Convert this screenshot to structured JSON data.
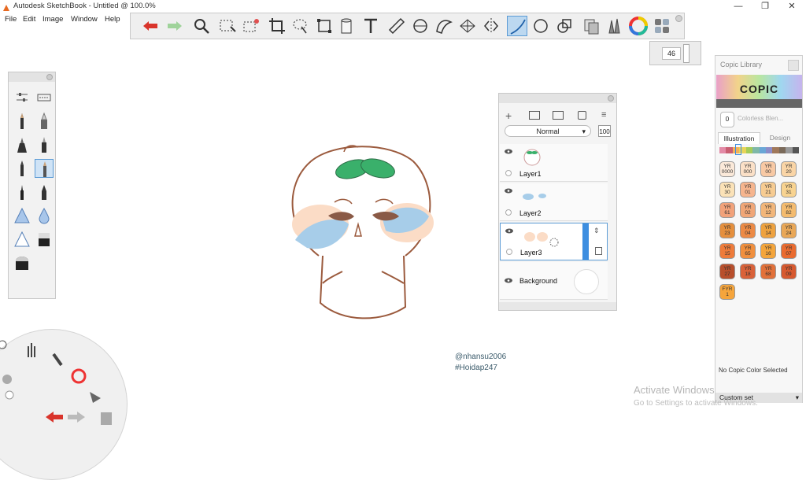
{
  "window": {
    "title": "Autodesk SketchBook - Untitled @ 100.0%",
    "controls": [
      "—",
      "❐",
      "✕"
    ]
  },
  "menu": {
    "items": [
      "File",
      "Edit",
      "Image",
      "Window",
      "Help"
    ]
  },
  "toolbar": {
    "tools": [
      "undo-icon",
      "redo-icon",
      "zoom-icon",
      "select-icon",
      "magic-select-icon",
      "crop-icon",
      "lasso-icon",
      "transform-icon",
      "fill-icon",
      "text-icon",
      "ruler-icon",
      "ellipse-guide-icon",
      "french-curve-icon",
      "perspective-icon",
      "symmetry-icon",
      "stroke-icon",
      "ellipse-icon",
      "shape-icon",
      "copy-icon",
      "brush-library-icon",
      "color-wheel-icon",
      "layout-icon"
    ],
    "selected": "stroke-icon"
  },
  "brush_size": {
    "value": "46"
  },
  "layer_editor": {
    "blend_mode": "Normal",
    "opacity": "100",
    "layers": [
      {
        "name": "Layer1"
      },
      {
        "name": "Layer2"
      },
      {
        "name": "Layer3",
        "selected": true
      },
      {
        "name": "Background"
      }
    ]
  },
  "copic": {
    "title": "Copic Library",
    "logo": "COPIC",
    "colorless_blender": {
      "code": "0",
      "label": "Colorless Blen..."
    },
    "tabs": [
      "Illustration",
      "Design"
    ],
    "active_tab": "Illustration",
    "chips": [
      {
        "code": "YR\n0000",
        "color": "#fbe9d9"
      },
      {
        "code": "YR\n000",
        "color": "#fbe0c7"
      },
      {
        "code": "YR\n00",
        "color": "#f8c9a4"
      },
      {
        "code": "YR\n20",
        "color": "#fad5a6"
      },
      {
        "code": "YR\n30",
        "color": "#fbe2b7"
      },
      {
        "code": "YR\n01",
        "color": "#f6b58e"
      },
      {
        "code": "YR\n21",
        "color": "#f7cc92"
      },
      {
        "code": "YR\n31",
        "color": "#f8d390"
      },
      {
        "code": "YR\n61",
        "color": "#f2a27a"
      },
      {
        "code": "YR\n02",
        "color": "#f0a677"
      },
      {
        "code": "YR\n12",
        "color": "#f2b67a"
      },
      {
        "code": "YR\n82",
        "color": "#f4bb6e"
      },
      {
        "code": "YR\n23",
        "color": "#e58f3d"
      },
      {
        "code": "YR\n04",
        "color": "#ec8a45"
      },
      {
        "code": "YR\n14",
        "color": "#eea23f"
      },
      {
        "code": "YR\n24",
        "color": "#e9a757"
      },
      {
        "code": "YR\n15",
        "color": "#ee7b3a"
      },
      {
        "code": "YR\n65",
        "color": "#f08f3e"
      },
      {
        "code": "YR\n16",
        "color": "#f4a53b"
      },
      {
        "code": "YR\n07",
        "color": "#ea6b2f"
      },
      {
        "code": "YR\n27",
        "color": "#b84f2c"
      },
      {
        "code": "YR\n18",
        "color": "#d9623a"
      },
      {
        "code": "YR\n68",
        "color": "#e2713a"
      },
      {
        "code": "YR\n09",
        "color": "#d7592f"
      },
      {
        "code": "FYR\n1",
        "color": "#f6a53c"
      }
    ],
    "swatch_strip": [
      "#e38aa6",
      "#c95f72",
      "#f2b05a",
      "#e8d45a",
      "#a6cc58",
      "#7fb8a8",
      "#6aa6d6",
      "#8c8cc8",
      "#a0785a",
      "#7a6a5a",
      "#999999",
      "#555555"
    ],
    "status": "No Copic Color Selected",
    "custom_set": "Custom set"
  },
  "canvas": {
    "credits": [
      "@nhansu2006",
      "#Hoidap247"
    ]
  },
  "watermark": {
    "line1": "Activate Windows",
    "line2": "Go to Settings to activate Windows."
  }
}
